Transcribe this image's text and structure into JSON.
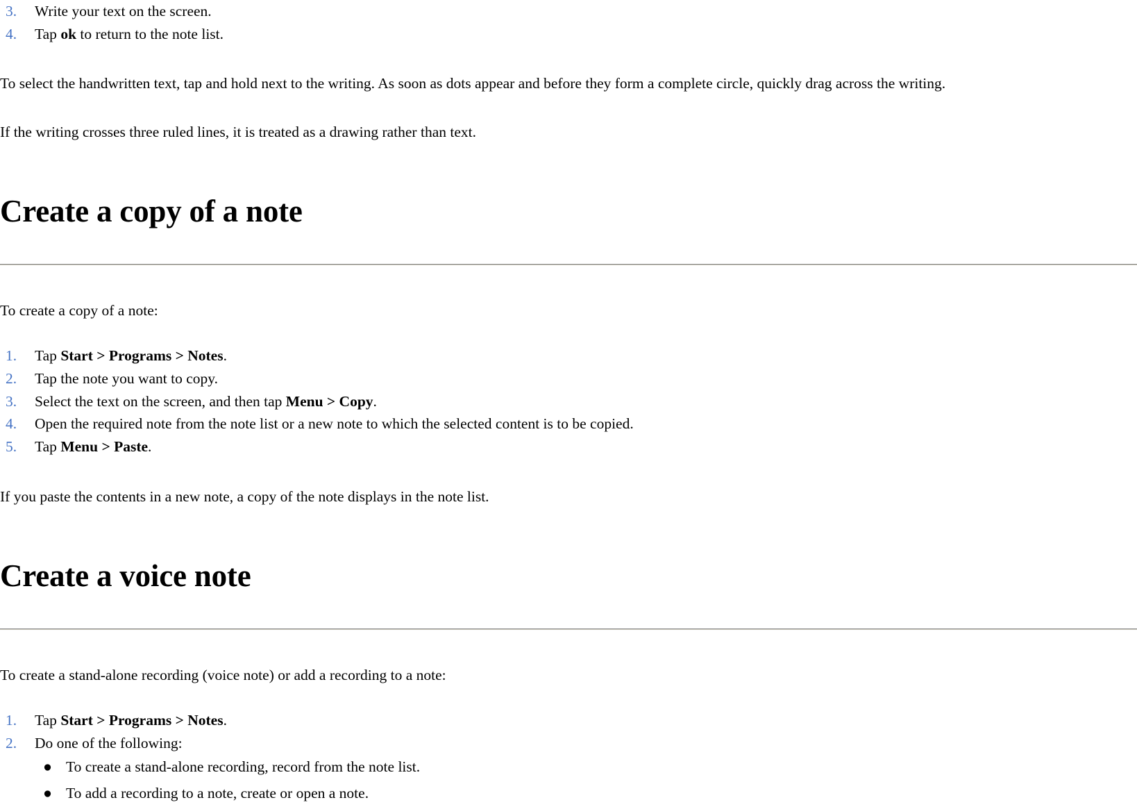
{
  "page": {
    "top_list": {
      "items": [
        {
          "number": "3.",
          "prefix": "Write your text on the screen.",
          "bold": "",
          "suffix": ""
        },
        {
          "number": "4.",
          "prefix": "Tap ",
          "bold": "ok",
          "suffix": " to return to the note list."
        }
      ]
    },
    "paragraphs": {
      "select_handwritten": "To select the handwritten text, tap and hold next to the writing. As soon as dots appear and before they form a complete circle, quickly drag across the writing.",
      "three_ruled_lines": "If the writing crosses three ruled lines, it is treated as a drawing rather than text.",
      "to_create_copy": "To create a copy of a note:",
      "paste_contents": "If you paste the contents in a new note, a copy of the note displays in the note list.",
      "to_create_standalone": "To create a stand-alone recording (voice note) or add a recording to a note:"
    },
    "sections": [
      {
        "id": "create-a-copy-of-a-note",
        "heading": "Create a copy of a note",
        "steps": [
          {
            "number": "1.",
            "prefix": "Tap ",
            "bold": "Start > Programs > Notes",
            "suffix": "."
          },
          {
            "number": "2.",
            "prefix": "Tap the note you want to copy.",
            "bold": "",
            "suffix": ""
          },
          {
            "number": "3.",
            "prefix": "Select the text on the screen, and then tap ",
            "bold": "Menu > Copy",
            "suffix": "."
          },
          {
            "number": "4.",
            "prefix": "Open the required note from the note list or a new note to which the selected content is to be copied.",
            "bold": "",
            "suffix": ""
          },
          {
            "number": "5.",
            "prefix": "Tap ",
            "bold": "Menu > Paste",
            "suffix": "."
          }
        ]
      },
      {
        "id": "create-a-voice-note",
        "heading": "Create a voice note",
        "steps": [
          {
            "number": "1.",
            "prefix": "Tap ",
            "bold": "Start > Programs > Notes",
            "suffix": "."
          },
          {
            "number": "2.",
            "prefix": "Do one of the following:",
            "bold": "",
            "suffix": ""
          }
        ],
        "sub_bullets": [
          {
            "bullet": "●",
            "text": "To create a stand-alone recording, record from the note list."
          },
          {
            "bullet": "●",
            "text": "To add a recording to a note, create or open a note."
          }
        ]
      }
    ],
    "colors": {
      "list_number": "#4472c4",
      "text": "#000000",
      "rule_top": "#808080",
      "rule_bottom": "#d6d2c4",
      "background": "#ffffff"
    }
  }
}
